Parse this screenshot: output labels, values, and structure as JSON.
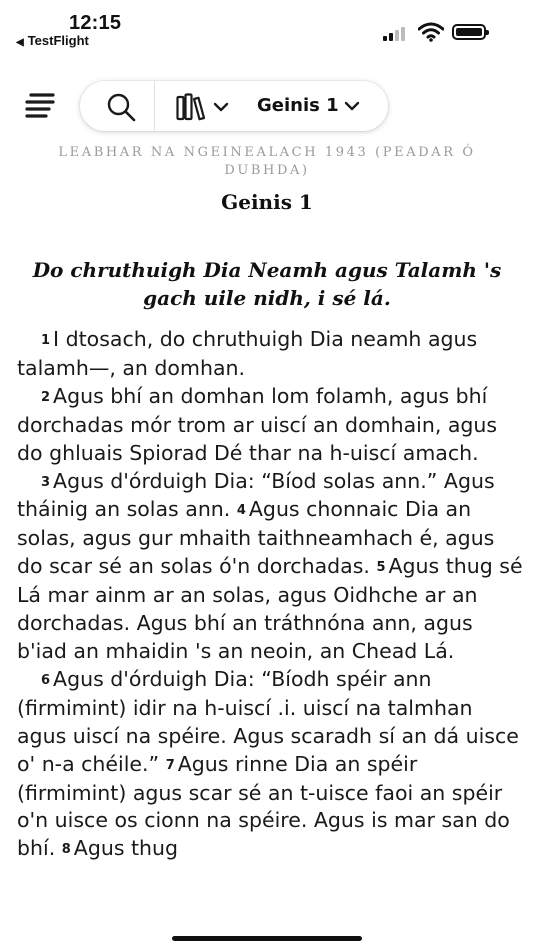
{
  "status_bar": {
    "time": "12:15",
    "back_app": "TestFlight"
  },
  "toolbar": {
    "book_selector_label": "Geinis 1"
  },
  "header": {
    "translation": "LEABHAR NA NGEINEALACH 1943 (PEADAR Ó DUBHDA)",
    "chapter_title": "Geinis 1",
    "section_heading": "Do chruthuigh Dia Neamh agus Talamh 's gach uile nidh, i sé lá."
  },
  "verses": [
    {
      "n": "1",
      "t": "I dtosach, do chruthuigh Dia neamh agus talamh—, an domhan."
    },
    {
      "n": "2",
      "t": "Agus bhí an domhan lom folamh, agus bhí dorchadas mór trom ar uiscí an domhain, agus do ghluais Spiorad Dé thar na h-uiscí amach."
    },
    {
      "n": "3",
      "t": "Agus d'órduigh Dia: “Bíod solas ann.” Agus tháinig an solas ann."
    },
    {
      "n": "4",
      "t": "Agus chonnaic Dia an solas, agus gur mhaith taithneamhach é, agus do scar sé an solas ó'n dorchadas."
    },
    {
      "n": "5",
      "t": "Agus thug sé Lá mar ainm ar an solas, agus Oidhche ar an dorchadas. Agus bhí an tráthnóna ann, agus b'iad an mhaidin 's an neoin, an Chead Lá."
    },
    {
      "n": "6",
      "t": "Agus d'órduigh Dia: “Bíodh spéir ann (firmimint) idir na h-uiscí .i. uiscí na talmhan agus uiscí na spéire. Agus scaradh sí an dá uisce o' n-a chéile.”"
    },
    {
      "n": "7",
      "t": "Agus rinne Dia an spéir (firmimint) agus scar sé an t-uisce faoi an spéir o'n uisce os cionn na spéire. Agus is mar san do bhí."
    },
    {
      "n": "8",
      "t": "Agus thug"
    }
  ],
  "icons": {
    "back": "back-triangle-icon",
    "menu": "menu-lines-icon",
    "search": "search-icon",
    "library": "library-books-icon",
    "dropdown": "chevron-down-icon"
  }
}
